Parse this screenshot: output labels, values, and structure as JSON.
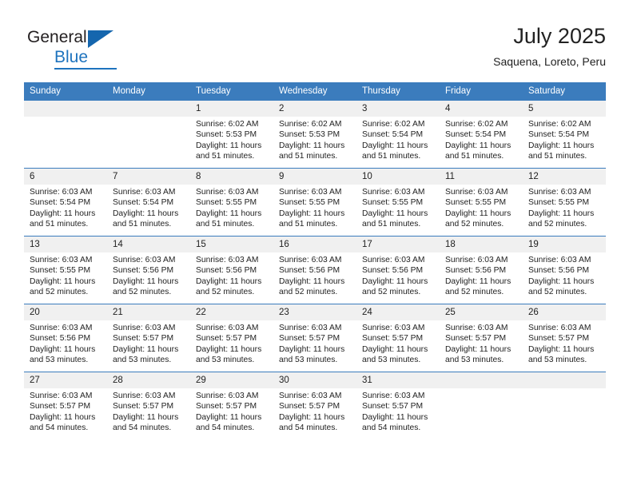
{
  "brand": {
    "name_part1": "General",
    "name_part2": "Blue",
    "triangle_icon": "blue-triangle-icon",
    "accent_color": "#1e73be"
  },
  "header": {
    "title": "July 2025",
    "subtitle": "Saquena, Loreto, Peru"
  },
  "theme": {
    "header_blue": "#3b7cbd",
    "daynum_band": "#f0f0f0",
    "text": "#222222"
  },
  "calendar": {
    "weekday_headers": [
      "Sunday",
      "Monday",
      "Tuesday",
      "Wednesday",
      "Thursday",
      "Friday",
      "Saturday"
    ],
    "weeks": [
      [
        {
          "day": "",
          "empty": true,
          "sunrise": "",
          "sunset": "",
          "daylight_line1": "",
          "daylight_line2": ""
        },
        {
          "day": "",
          "empty": true,
          "sunrise": "",
          "sunset": "",
          "daylight_line1": "",
          "daylight_line2": ""
        },
        {
          "day": "1",
          "empty": false,
          "sunrise": "Sunrise: 6:02 AM",
          "sunset": "Sunset: 5:53 PM",
          "daylight_line1": "Daylight: 11 hours",
          "daylight_line2": "and 51 minutes."
        },
        {
          "day": "2",
          "empty": false,
          "sunrise": "Sunrise: 6:02 AM",
          "sunset": "Sunset: 5:53 PM",
          "daylight_line1": "Daylight: 11 hours",
          "daylight_line2": "and 51 minutes."
        },
        {
          "day": "3",
          "empty": false,
          "sunrise": "Sunrise: 6:02 AM",
          "sunset": "Sunset: 5:54 PM",
          "daylight_line1": "Daylight: 11 hours",
          "daylight_line2": "and 51 minutes."
        },
        {
          "day": "4",
          "empty": false,
          "sunrise": "Sunrise: 6:02 AM",
          "sunset": "Sunset: 5:54 PM",
          "daylight_line1": "Daylight: 11 hours",
          "daylight_line2": "and 51 minutes."
        },
        {
          "day": "5",
          "empty": false,
          "sunrise": "Sunrise: 6:02 AM",
          "sunset": "Sunset: 5:54 PM",
          "daylight_line1": "Daylight: 11 hours",
          "daylight_line2": "and 51 minutes."
        }
      ],
      [
        {
          "day": "6",
          "empty": false,
          "sunrise": "Sunrise: 6:03 AM",
          "sunset": "Sunset: 5:54 PM",
          "daylight_line1": "Daylight: 11 hours",
          "daylight_line2": "and 51 minutes."
        },
        {
          "day": "7",
          "empty": false,
          "sunrise": "Sunrise: 6:03 AM",
          "sunset": "Sunset: 5:54 PM",
          "daylight_line1": "Daylight: 11 hours",
          "daylight_line2": "and 51 minutes."
        },
        {
          "day": "8",
          "empty": false,
          "sunrise": "Sunrise: 6:03 AM",
          "sunset": "Sunset: 5:55 PM",
          "daylight_line1": "Daylight: 11 hours",
          "daylight_line2": "and 51 minutes."
        },
        {
          "day": "9",
          "empty": false,
          "sunrise": "Sunrise: 6:03 AM",
          "sunset": "Sunset: 5:55 PM",
          "daylight_line1": "Daylight: 11 hours",
          "daylight_line2": "and 51 minutes."
        },
        {
          "day": "10",
          "empty": false,
          "sunrise": "Sunrise: 6:03 AM",
          "sunset": "Sunset: 5:55 PM",
          "daylight_line1": "Daylight: 11 hours",
          "daylight_line2": "and 51 minutes."
        },
        {
          "day": "11",
          "empty": false,
          "sunrise": "Sunrise: 6:03 AM",
          "sunset": "Sunset: 5:55 PM",
          "daylight_line1": "Daylight: 11 hours",
          "daylight_line2": "and 52 minutes."
        },
        {
          "day": "12",
          "empty": false,
          "sunrise": "Sunrise: 6:03 AM",
          "sunset": "Sunset: 5:55 PM",
          "daylight_line1": "Daylight: 11 hours",
          "daylight_line2": "and 52 minutes."
        }
      ],
      [
        {
          "day": "13",
          "empty": false,
          "sunrise": "Sunrise: 6:03 AM",
          "sunset": "Sunset: 5:55 PM",
          "daylight_line1": "Daylight: 11 hours",
          "daylight_line2": "and 52 minutes."
        },
        {
          "day": "14",
          "empty": false,
          "sunrise": "Sunrise: 6:03 AM",
          "sunset": "Sunset: 5:56 PM",
          "daylight_line1": "Daylight: 11 hours",
          "daylight_line2": "and 52 minutes."
        },
        {
          "day": "15",
          "empty": false,
          "sunrise": "Sunrise: 6:03 AM",
          "sunset": "Sunset: 5:56 PM",
          "daylight_line1": "Daylight: 11 hours",
          "daylight_line2": "and 52 minutes."
        },
        {
          "day": "16",
          "empty": false,
          "sunrise": "Sunrise: 6:03 AM",
          "sunset": "Sunset: 5:56 PM",
          "daylight_line1": "Daylight: 11 hours",
          "daylight_line2": "and 52 minutes."
        },
        {
          "day": "17",
          "empty": false,
          "sunrise": "Sunrise: 6:03 AM",
          "sunset": "Sunset: 5:56 PM",
          "daylight_line1": "Daylight: 11 hours",
          "daylight_line2": "and 52 minutes."
        },
        {
          "day": "18",
          "empty": false,
          "sunrise": "Sunrise: 6:03 AM",
          "sunset": "Sunset: 5:56 PM",
          "daylight_line1": "Daylight: 11 hours",
          "daylight_line2": "and 52 minutes."
        },
        {
          "day": "19",
          "empty": false,
          "sunrise": "Sunrise: 6:03 AM",
          "sunset": "Sunset: 5:56 PM",
          "daylight_line1": "Daylight: 11 hours",
          "daylight_line2": "and 52 minutes."
        }
      ],
      [
        {
          "day": "20",
          "empty": false,
          "sunrise": "Sunrise: 6:03 AM",
          "sunset": "Sunset: 5:56 PM",
          "daylight_line1": "Daylight: 11 hours",
          "daylight_line2": "and 53 minutes."
        },
        {
          "day": "21",
          "empty": false,
          "sunrise": "Sunrise: 6:03 AM",
          "sunset": "Sunset: 5:57 PM",
          "daylight_line1": "Daylight: 11 hours",
          "daylight_line2": "and 53 minutes."
        },
        {
          "day": "22",
          "empty": false,
          "sunrise": "Sunrise: 6:03 AM",
          "sunset": "Sunset: 5:57 PM",
          "daylight_line1": "Daylight: 11 hours",
          "daylight_line2": "and 53 minutes."
        },
        {
          "day": "23",
          "empty": false,
          "sunrise": "Sunrise: 6:03 AM",
          "sunset": "Sunset: 5:57 PM",
          "daylight_line1": "Daylight: 11 hours",
          "daylight_line2": "and 53 minutes."
        },
        {
          "day": "24",
          "empty": false,
          "sunrise": "Sunrise: 6:03 AM",
          "sunset": "Sunset: 5:57 PM",
          "daylight_line1": "Daylight: 11 hours",
          "daylight_line2": "and 53 minutes."
        },
        {
          "day": "25",
          "empty": false,
          "sunrise": "Sunrise: 6:03 AM",
          "sunset": "Sunset: 5:57 PM",
          "daylight_line1": "Daylight: 11 hours",
          "daylight_line2": "and 53 minutes."
        },
        {
          "day": "26",
          "empty": false,
          "sunrise": "Sunrise: 6:03 AM",
          "sunset": "Sunset: 5:57 PM",
          "daylight_line1": "Daylight: 11 hours",
          "daylight_line2": "and 53 minutes."
        }
      ],
      [
        {
          "day": "27",
          "empty": false,
          "sunrise": "Sunrise: 6:03 AM",
          "sunset": "Sunset: 5:57 PM",
          "daylight_line1": "Daylight: 11 hours",
          "daylight_line2": "and 54 minutes."
        },
        {
          "day": "28",
          "empty": false,
          "sunrise": "Sunrise: 6:03 AM",
          "sunset": "Sunset: 5:57 PM",
          "daylight_line1": "Daylight: 11 hours",
          "daylight_line2": "and 54 minutes."
        },
        {
          "day": "29",
          "empty": false,
          "sunrise": "Sunrise: 6:03 AM",
          "sunset": "Sunset: 5:57 PM",
          "daylight_line1": "Daylight: 11 hours",
          "daylight_line2": "and 54 minutes."
        },
        {
          "day": "30",
          "empty": false,
          "sunrise": "Sunrise: 6:03 AM",
          "sunset": "Sunset: 5:57 PM",
          "daylight_line1": "Daylight: 11 hours",
          "daylight_line2": "and 54 minutes."
        },
        {
          "day": "31",
          "empty": false,
          "sunrise": "Sunrise: 6:03 AM",
          "sunset": "Sunset: 5:57 PM",
          "daylight_line1": "Daylight: 11 hours",
          "daylight_line2": "and 54 minutes."
        },
        {
          "day": "",
          "empty": true,
          "sunrise": "",
          "sunset": "",
          "daylight_line1": "",
          "daylight_line2": ""
        },
        {
          "day": "",
          "empty": true,
          "sunrise": "",
          "sunset": "",
          "daylight_line1": "",
          "daylight_line2": ""
        }
      ]
    ]
  }
}
